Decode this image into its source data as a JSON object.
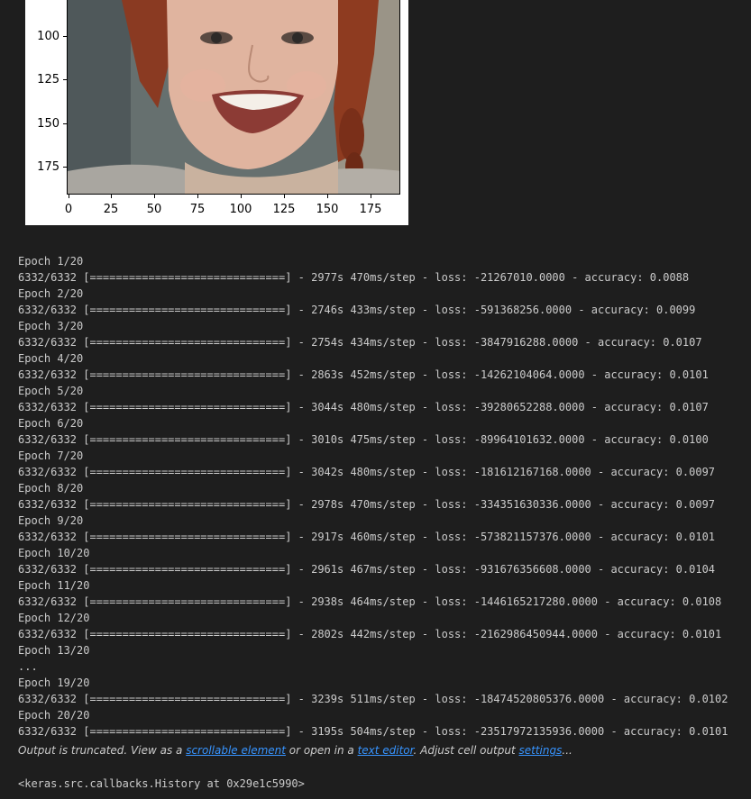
{
  "plot": {
    "image_alt": "photo of a smiling woman with red hair",
    "yticks": [
      "100",
      "125",
      "150",
      "175"
    ],
    "xticks": [
      "0",
      "25",
      "50",
      "75",
      "100",
      "125",
      "150",
      "175"
    ]
  },
  "training_log": [
    "Epoch 1/20",
    "6332/6332 [==============================] - 2977s 470ms/step - loss: -21267010.0000 - accuracy: 0.0088",
    "Epoch 2/20",
    "6332/6332 [==============================] - 2746s 433ms/step - loss: -591368256.0000 - accuracy: 0.0099",
    "Epoch 3/20",
    "6332/6332 [==============================] - 2754s 434ms/step - loss: -3847916288.0000 - accuracy: 0.0107",
    "Epoch 4/20",
    "6332/6332 [==============================] - 2863s 452ms/step - loss: -14262104064.0000 - accuracy: 0.0101",
    "Epoch 5/20",
    "6332/6332 [==============================] - 3044s 480ms/step - loss: -39280652288.0000 - accuracy: 0.0107",
    "Epoch 6/20",
    "6332/6332 [==============================] - 3010s 475ms/step - loss: -89964101632.0000 - accuracy: 0.0100",
    "Epoch 7/20",
    "6332/6332 [==============================] - 3042s 480ms/step - loss: -181612167168.0000 - accuracy: 0.0097",
    "Epoch 8/20",
    "6332/6332 [==============================] - 2978s 470ms/step - loss: -334351630336.0000 - accuracy: 0.0097",
    "Epoch 9/20",
    "6332/6332 [==============================] - 2917s 460ms/step - loss: -573821157376.0000 - accuracy: 0.0101",
    "Epoch 10/20",
    "6332/6332 [==============================] - 2961s 467ms/step - loss: -931676356608.0000 - accuracy: 0.0104",
    "Epoch 11/20",
    "6332/6332 [==============================] - 2938s 464ms/step - loss: -1446165217280.0000 - accuracy: 0.0108",
    "Epoch 12/20",
    "6332/6332 [==============================] - 2802s 442ms/step - loss: -2162986450944.0000 - accuracy: 0.0101",
    "Epoch 13/20",
    "...",
    "Epoch 19/20",
    "6332/6332 [==============================] - 3239s 511ms/step - loss: -18474520805376.0000 - accuracy: 0.0102",
    "Epoch 20/20",
    "6332/6332 [==============================] - 3195s 504ms/step - loss: -23517972135936.0000 - accuracy: 0.0101"
  ],
  "truncation": {
    "prefix": "Output is truncated. View as a ",
    "link_scrollable": "scrollable element",
    "middle": " or open in a ",
    "link_editor": "text editor",
    "suffix_before_settings": ". Adjust cell output ",
    "link_settings": "settings",
    "ellipsis": "..."
  },
  "result_text": "<keras.src.callbacks.History at 0x29e1c5990>",
  "colors": {
    "background": "#1e1e1e",
    "text": "#cccccc",
    "link": "#3794ff"
  }
}
